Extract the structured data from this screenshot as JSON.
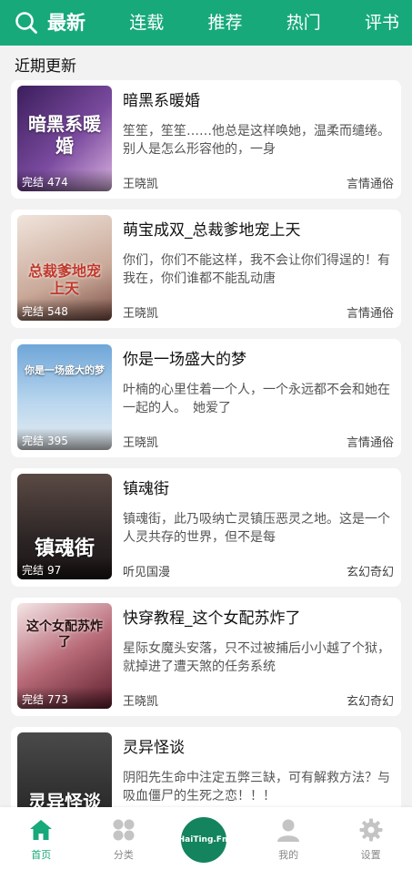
{
  "header": {
    "tabs": [
      {
        "label": "最新",
        "active": true
      },
      {
        "label": "连载",
        "active": false
      },
      {
        "label": "推荐",
        "active": false
      },
      {
        "label": "热门",
        "active": false
      },
      {
        "label": "评书",
        "active": false
      }
    ],
    "search_icon": "search-icon",
    "accent_color": "#17a97a"
  },
  "section": {
    "title": "近期更新"
  },
  "books": [
    {
      "title": "暗黑系暖婚",
      "desc": "笙笙，笙笙……他总是这样唤她，温柔而缱绻。别人是怎么形容他的，一身",
      "author": "王晓凯",
      "genre": "言情通俗",
      "status": "完结",
      "count": "474",
      "cover_text": "暗黑系暖婚",
      "cover_color": "#6a3a8c"
    },
    {
      "title": "萌宝成双_总裁爹地宠上天",
      "desc": "你们，你们不能这样，我不会让你们得逞的！有我在，你们谁都不能乱动唐",
      "author": "王晓凯",
      "genre": "言情通俗",
      "status": "完结",
      "count": "548",
      "cover_text": "总裁爹地宠上天",
      "cover_color": "#c9b3a8"
    },
    {
      "title": "你是一场盛大的梦",
      "desc": "叶楠的心里住着一个人，一个永远都不会和她在一起的人。　她爱了",
      "author": "王晓凯",
      "genre": "言情通俗",
      "status": "完结",
      "count": "395",
      "cover_text": "你是一场盛大的梦",
      "cover_color": "#8fb6d9"
    },
    {
      "title": "镇魂街",
      "desc": "镇魂街，此乃吸纳亡灵镇压恶灵之地。这是一个人灵共存的世界，但不是每",
      "author": "听见国漫",
      "genre": "玄幻奇幻",
      "status": "完结",
      "count": "97",
      "cover_text": "镇魂街",
      "cover_color": "#3a2e2e"
    },
    {
      "title": "快穿教程_这个女配苏炸了",
      "desc": "星际女魔头安落，只不过被捕后小小越了个狱，就掉进了遭天煞的任务系统",
      "author": "王晓凯",
      "genre": "玄幻奇幻",
      "status": "完结",
      "count": "773",
      "cover_text": "这个女配苏炸了",
      "cover_color": "#8a2e3e"
    },
    {
      "title": "灵异怪谈",
      "desc": "阴阳先生命中注定五弊三缺，可有解救方法？与吸血僵尸的生死之恋！！！",
      "author": "",
      "genre": "",
      "status": "",
      "count": "",
      "cover_text": "灵异怪谈",
      "cover_color": "#2a2a2a"
    }
  ],
  "nav": {
    "items": [
      {
        "label": "首页",
        "icon": "home-icon",
        "active": true
      },
      {
        "label": "分类",
        "icon": "grid-icon",
        "active": false
      },
      {
        "label": "",
        "icon": "radio-icon",
        "active": false
      },
      {
        "label": "我的",
        "icon": "user-icon",
        "active": false
      },
      {
        "label": "设置",
        "icon": "gear-icon",
        "active": false
      }
    ],
    "radio_label": "HaiTing.Fm"
  }
}
